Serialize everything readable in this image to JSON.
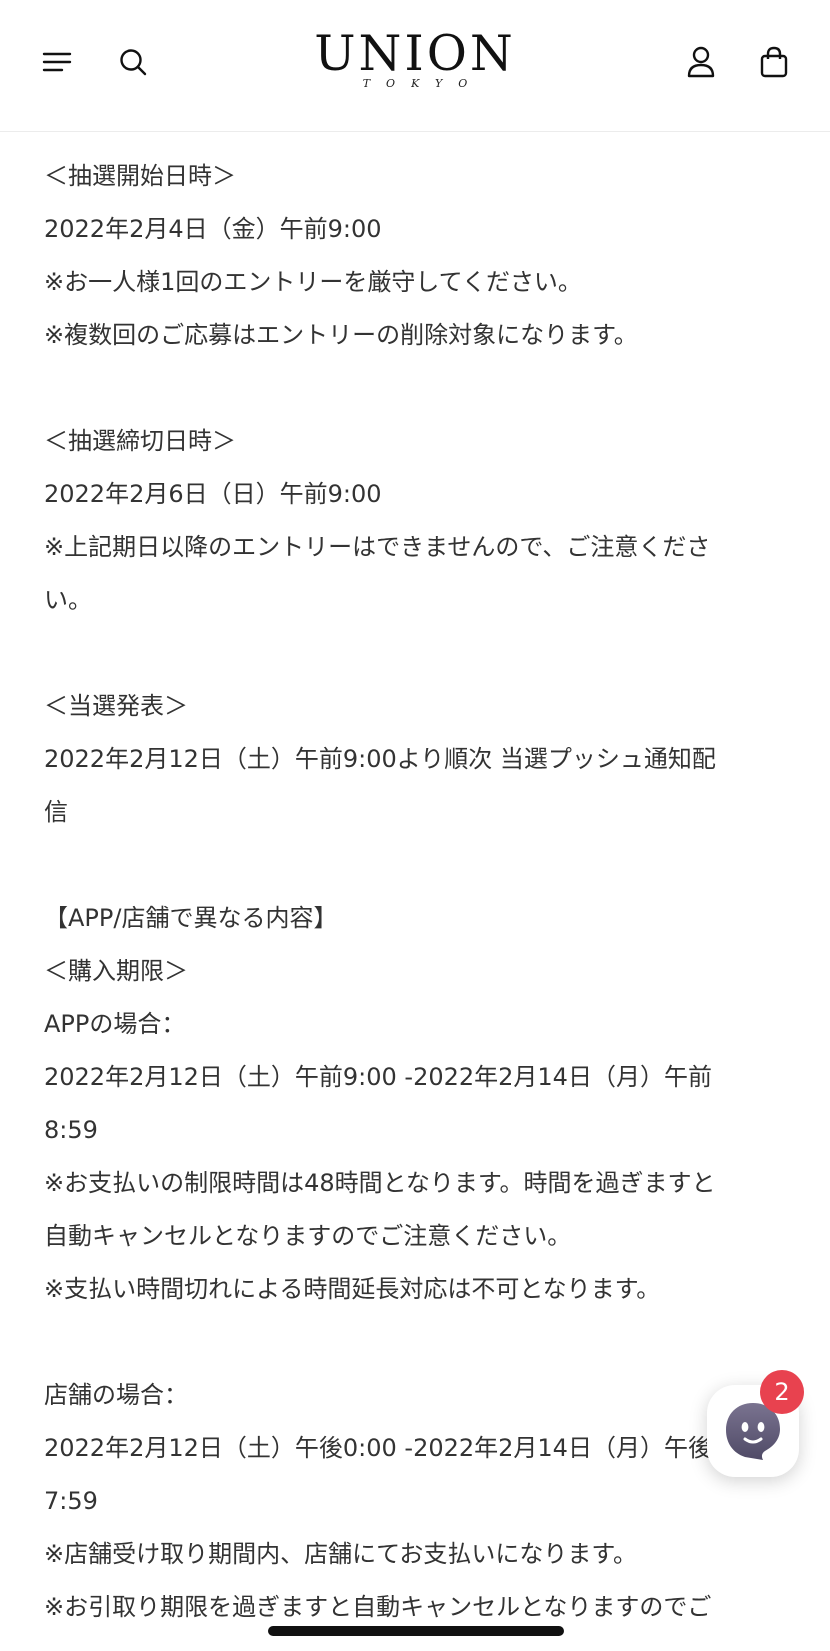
{
  "header": {
    "logo_main": "UNION",
    "logo_sub": "TOKYO",
    "icons": {
      "menu": "hamburger-menu-icon",
      "search": "search-icon",
      "account": "user-icon",
      "cart": "shopping-bag-icon"
    }
  },
  "content": {
    "lines": [
      "＜抽選開始日時＞",
      "2022年2月4日（金）午前9:00",
      "※お一人様1回のエントリーを厳守してください。",
      "※複数回のご応募はエントリーの削除対象になります。",
      "",
      "＜抽選締切日時＞",
      "2022年2月6日（日）午前9:00",
      "※上記期日以降のエントリーはできませんので、ご注意くださ",
      "い。",
      "",
      "＜当選発表＞",
      "2022年2月12日（土）午前9:00より順次 当選プッシュ通知配",
      "信",
      "",
      "【APP/店舗で異なる内容】",
      "＜購入期限＞",
      "APPの場合：",
      "2022年2月12日（土）午前9:00 -2022年2月14日（月）午前",
      "8:59",
      "※お支払いの制限時間は48時間となります。時間を過ぎますと",
      "自動キャンセルとなりますのでご注意ください。",
      "※支払い時間切れによる時間延長対応は不可となります。",
      "",
      "店舗の場合：",
      "2022年2月12日（土）午後0:00 -2022年2月14日（月）午後",
      "7:59",
      "※店舗受け取り期間内、店舗にてお支払いになります。",
      "※お引取り期限を過ぎますと自動キャンセルとなりますのでご"
    ]
  },
  "chat": {
    "badge_count": "2",
    "icon": "chat-ghost-icon",
    "badge_color": "#e8424f"
  }
}
